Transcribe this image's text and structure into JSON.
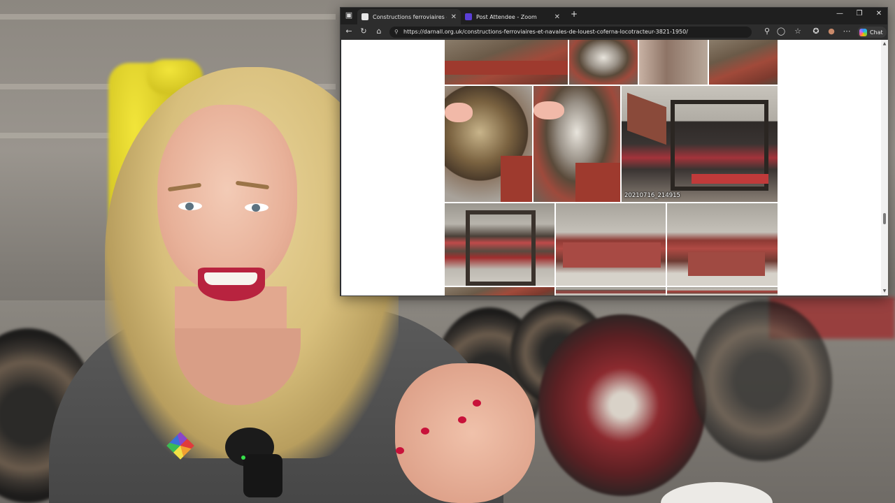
{
  "browser": {
    "tabs": [
      {
        "label": "Constructions ferroviaires et navales",
        "active": true
      },
      {
        "label": "Post Attendee - Zoom",
        "active": false
      }
    ],
    "new_tab_label": "+",
    "address_url": "https://darnall.org.uk/constructions-ferroviaires-et-navales-de-louest-coferna-locotracteur-3821-1950/",
    "chat_label": "Chat"
  },
  "gallery": {
    "photo_caption": "20210716_214915"
  },
  "icons": {
    "tab_actions": "tab-actions-icon",
    "back": "back-arrow-icon",
    "reload": "reload-icon",
    "home": "home-icon",
    "lock": "lock-icon",
    "zoom": "zoom-icon",
    "reader": "reader-icon",
    "favorite": "star-icon",
    "collections": "collections-icon",
    "profile": "profile-icon",
    "menu": "more-icon"
  },
  "colors": {
    "browser_chrome": "#202124",
    "address_bar": "#1c1c1c",
    "page_bg": "#ffffff",
    "frame_red": "#a3333a"
  }
}
